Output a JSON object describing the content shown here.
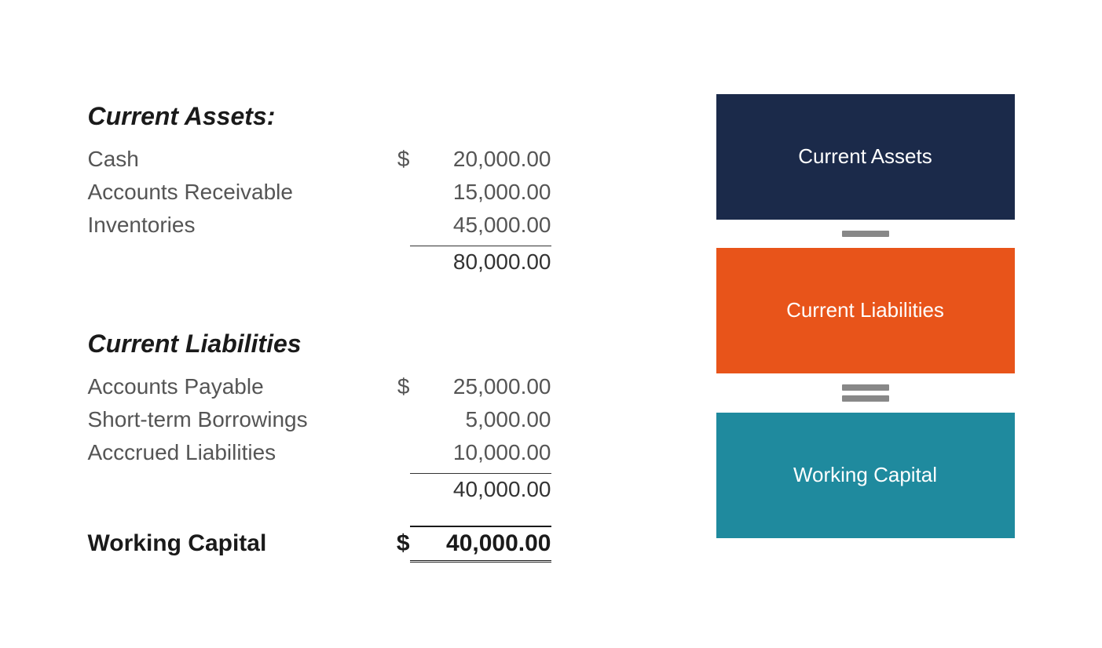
{
  "currentAssets": {
    "header": "Current Assets:",
    "items": [
      {
        "label": "Cash",
        "dollar": "$",
        "value": "20,000.00"
      },
      {
        "label": "Accounts Receivable",
        "dollar": "",
        "value": "15,000.00"
      },
      {
        "label": "Inventories",
        "dollar": "",
        "value": "45,000.00"
      }
    ],
    "subtotal": "80,000.00"
  },
  "currentLiabilities": {
    "header": "Current Liabilities",
    "items": [
      {
        "label": "Accounts Payable",
        "dollar": "$",
        "value": "25,000.00"
      },
      {
        "label": "Short-term Borrowings",
        "dollar": "",
        "value": "5,000.00"
      },
      {
        "label": "Acccrued Liabilities",
        "dollar": "",
        "value": "10,000.00"
      }
    ],
    "subtotal": "40,000.00"
  },
  "workingCapital": {
    "label": "Working Capital",
    "dollar": "$",
    "value": "40,000.00"
  },
  "cards": {
    "currentAssets": "Current Assets",
    "currentLiabilities": "Current Liabilities",
    "workingCapital": "Working Capital"
  }
}
